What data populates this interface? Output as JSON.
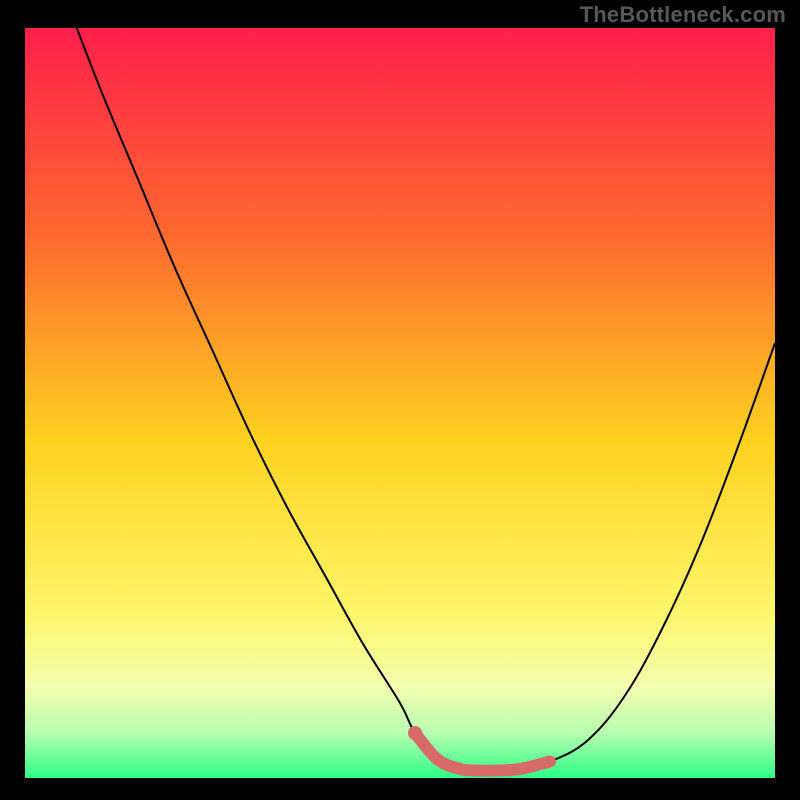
{
  "watermark": "TheBottleneck.com",
  "colors": {
    "bg": "#000000",
    "grad_top": "#ff1f4b",
    "grad_mid_upper": "#ff6a2f",
    "grad_mid": "#ffd21f",
    "grad_mid_lower": "#fff66a",
    "grad_low1": "#f3ffb0",
    "grad_low2": "#b8ffb0",
    "grad_bottom": "#2cff87",
    "curve": "#000000",
    "marker": "#d96a6a"
  },
  "chart_data": {
    "type": "line",
    "title": "",
    "xlabel": "",
    "ylabel": "",
    "xlim": [
      0,
      100
    ],
    "ylim": [
      0,
      100
    ],
    "series": [
      {
        "name": "bottleneck-curve",
        "x": [
          0,
          5,
          10,
          15,
          20,
          25,
          30,
          35,
          40,
          45,
          50,
          52,
          55,
          58,
          60,
          63,
          66,
          70,
          75,
          80,
          85,
          90,
          95,
          100
        ],
        "values": [
          118,
          105,
          92,
          80,
          68,
          57,
          46,
          36,
          27,
          18,
          10,
          6,
          2.5,
          1.2,
          1,
          1,
          1.2,
          2.2,
          5,
          11,
          20,
          31,
          44,
          58
        ]
      },
      {
        "name": "optimal-zone-marker",
        "x": [
          52,
          55,
          58,
          60,
          63,
          66,
          70
        ],
        "values": [
          6,
          2.5,
          1.2,
          1,
          1,
          1.2,
          2.2
        ]
      }
    ],
    "annotations": []
  }
}
